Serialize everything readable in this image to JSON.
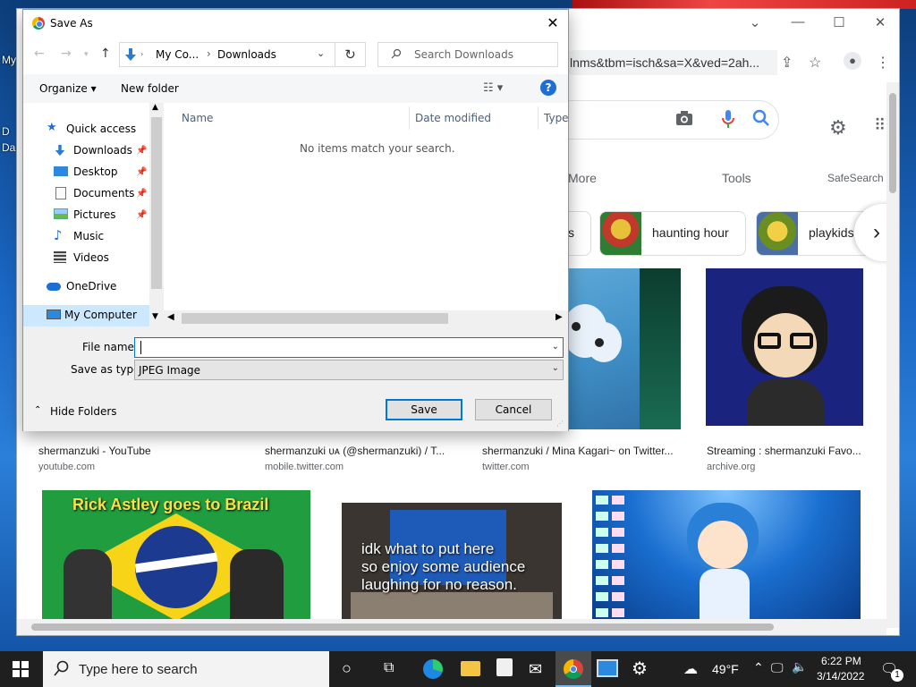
{
  "desktop": {
    "labels": [
      "My",
      "D",
      "Da"
    ]
  },
  "chrome": {
    "omnibox_text": "lnms&tbm=isch&sa=X&ved=2ah...",
    "tabs": {
      "more": "More",
      "tools": "Tools",
      "safesearch": "SafeSearch"
    },
    "chips": [
      {
        "label": "s"
      },
      {
        "label": "haunting hour"
      },
      {
        "label": "playkids"
      }
    ],
    "results": [
      {
        "title": "shermanzuki - YouTube",
        "source": "youtube.com"
      },
      {
        "title": "shermanzuki ᴜᴀ (@shermanzuki) / T...",
        "source": "mobile.twitter.com"
      },
      {
        "title": "shermanzuki / Mina Kagari~ on Twitter...",
        "source": "twitter.com"
      },
      {
        "title": "Streaming : shermanzuki Favo...",
        "source": "archive.org"
      }
    ],
    "image_captions": {
      "rick": "Rick Astley goes to Brazil",
      "laptop_line1": "idk what to put here",
      "laptop_line2": "so enjoy some audience",
      "laptop_line3": "laughing for no reason."
    }
  },
  "dialog": {
    "title": "Save As",
    "close_glyph": "✕",
    "breadcrumb": [
      "My Co...",
      "Downloads"
    ],
    "search_placeholder": "Search Downloads",
    "organize_label": "Organize ▾",
    "new_folder_label": "New folder",
    "nav_pane": [
      {
        "label": "Quick access",
        "icon": "star-icon",
        "pinned": false
      },
      {
        "label": "Downloads",
        "icon": "download-arrow-icon",
        "pinned": true
      },
      {
        "label": "Desktop",
        "icon": "desktop-icon",
        "pinned": true
      },
      {
        "label": "Documents",
        "icon": "documents-icon",
        "pinned": true
      },
      {
        "label": "Pictures",
        "icon": "pictures-icon",
        "pinned": true
      },
      {
        "label": "Music",
        "icon": "music-note-icon",
        "pinned": false
      },
      {
        "label": "Videos",
        "icon": "videos-icon",
        "pinned": false
      },
      {
        "label": "OneDrive",
        "icon": "cloud-icon",
        "pinned": false
      },
      {
        "label": "My Computer",
        "icon": "computer-icon",
        "pinned": false
      }
    ],
    "columns": [
      "Name",
      "Date modified",
      "Type"
    ],
    "empty_message": "No items match your search.",
    "file_name_label": "File name:",
    "file_name_value": "",
    "save_as_type_label": "Save as type:",
    "save_as_type_value": "JPEG Image",
    "hide_folders_label": "Hide Folders",
    "save_button": "Save",
    "cancel_button": "Cancel"
  },
  "taskbar": {
    "search_placeholder": "Type here to search",
    "temperature": "49°F",
    "time": "6:22 PM",
    "date": "3/14/2022",
    "notification_count": "1"
  },
  "colors": {
    "accent": "#0078d7",
    "taskbar_bg": "#1f1f1f",
    "google_blue": "#1a73e8"
  }
}
